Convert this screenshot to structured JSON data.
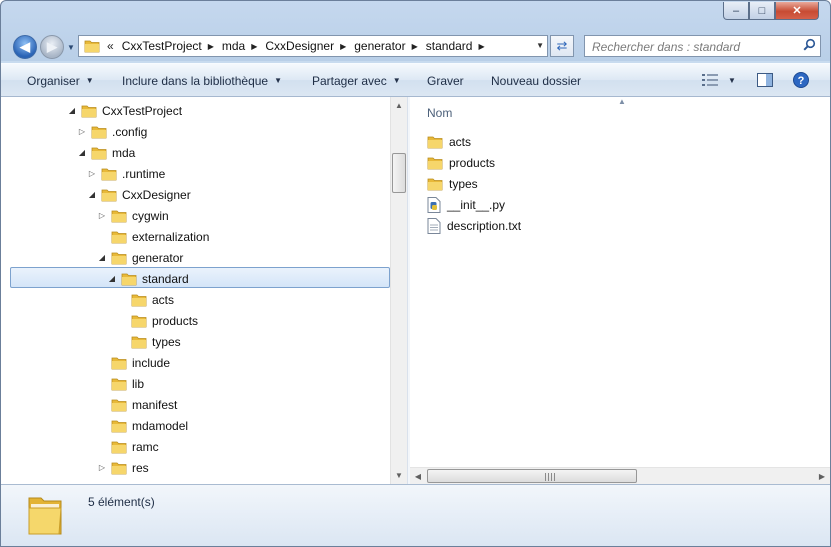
{
  "window": {
    "minimize_glyph": "–",
    "maximize_glyph": "□",
    "close_glyph": "✕"
  },
  "nav": {
    "back_glyph": "◀",
    "forward_glyph": "▶",
    "history_glyph": "▼",
    "overflow_glyph": "«",
    "breadcrumb": [
      "CxxTestProject",
      "mda",
      "CxxDesigner",
      "generator",
      "standard"
    ],
    "refresh_glyph": "⇄",
    "search_placeholder": "Rechercher dans : standard"
  },
  "toolbar": {
    "organize": "Organiser",
    "include_library": "Inclure dans la bibliothèque",
    "share_with": "Partager avec",
    "burn": "Graver",
    "new_folder": "Nouveau dossier"
  },
  "tree": [
    {
      "label": "CxxTestProject",
      "depth": 0,
      "expander": "open"
    },
    {
      "label": ".config",
      "depth": 1,
      "expander": "closed"
    },
    {
      "label": "mda",
      "depth": 1,
      "expander": "open"
    },
    {
      "label": ".runtime",
      "depth": 2,
      "expander": "closed"
    },
    {
      "label": "CxxDesigner",
      "depth": 2,
      "expander": "open"
    },
    {
      "label": "cygwin",
      "depth": 3,
      "expander": "closed"
    },
    {
      "label": "externalization",
      "depth": 3,
      "expander": "none"
    },
    {
      "label": "generator",
      "depth": 3,
      "expander": "open"
    },
    {
      "label": "standard",
      "depth": 4,
      "expander": "open",
      "selected": true
    },
    {
      "label": "acts",
      "depth": 5,
      "expander": "none"
    },
    {
      "label": "products",
      "depth": 5,
      "expander": "none"
    },
    {
      "label": "types",
      "depth": 5,
      "expander": "none"
    },
    {
      "label": "include",
      "depth": 3,
      "expander": "none"
    },
    {
      "label": "lib",
      "depth": 3,
      "expander": "none"
    },
    {
      "label": "manifest",
      "depth": 3,
      "expander": "none"
    },
    {
      "label": "mdamodel",
      "depth": 3,
      "expander": "none"
    },
    {
      "label": "ramc",
      "depth": 3,
      "expander": "none"
    },
    {
      "label": "res",
      "depth": 3,
      "expander": "closed"
    }
  ],
  "files": {
    "column_name": "Nom",
    "items": [
      {
        "label": "acts",
        "icon": "folder-icon"
      },
      {
        "label": "products",
        "icon": "folder-icon"
      },
      {
        "label": "types",
        "icon": "folder-icon"
      },
      {
        "label": "__init__.py",
        "icon": "python-file-icon"
      },
      {
        "label": "description.txt",
        "icon": "text-file-icon"
      }
    ]
  },
  "details": {
    "count_text": "5 élément(s)"
  },
  "colors": {
    "selection_border": "#7da2ce",
    "folder_yellow": "#f3cf5a",
    "close_red": "#c74b33"
  }
}
